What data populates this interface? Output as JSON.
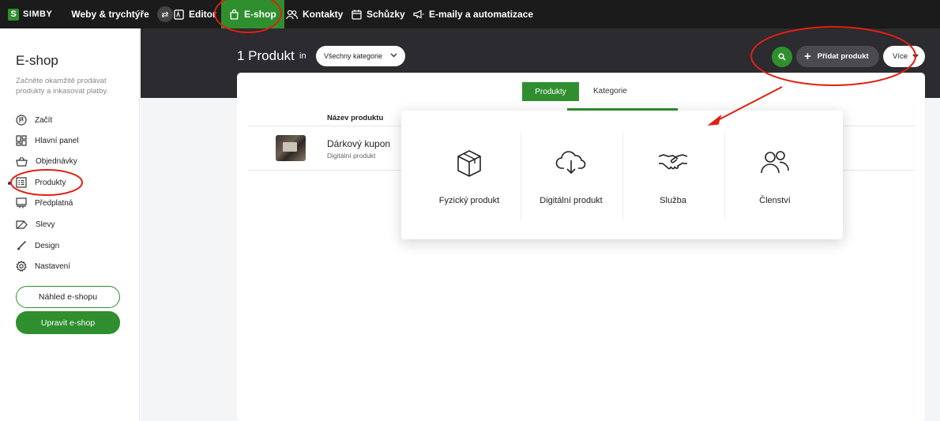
{
  "topbar": {
    "logo_letter": "S",
    "logo_text": "SIMBY",
    "site_name": "Weby & trychtýře",
    "swap_icon": "⇄",
    "nav": {
      "editor": "Editor",
      "eshop": "E-shop",
      "kontakty": "Kontakty",
      "schuzky": "Schůzky",
      "emaily": "E-maily a automatizace"
    }
  },
  "sidebar": {
    "title": "E-shop",
    "description": "Začněte okamžitě prodávat produkty a inkasovat platby.",
    "items": [
      {
        "label": "Začít",
        "icon": "flag-circle-icon"
      },
      {
        "label": "Hlavní panel",
        "icon": "dashboard-icon"
      },
      {
        "label": "Objednávky",
        "icon": "basket-icon"
      },
      {
        "label": "Produkty",
        "icon": "product-list-icon"
      },
      {
        "label": "Předplatná",
        "icon": "subscription-icon"
      },
      {
        "label": "Slevy",
        "icon": "discount-tag-icon"
      },
      {
        "label": "Design",
        "icon": "brush-icon"
      },
      {
        "label": "Nastavení",
        "icon": "gear-icon"
      }
    ],
    "preview_button": "Náhled e-shopu",
    "edit_button": "Upravit e-shop"
  },
  "main": {
    "heading": "1 Produkt",
    "heading_in": "in",
    "category_select": "Všechny kategorie",
    "add_product": "Přidat produkt",
    "more": "Více",
    "tabs": [
      "Produkty",
      "Kategorie"
    ],
    "table": {
      "column_header": "Název produktu",
      "rows": [
        {
          "name": "Dárkový kupon",
          "type": "Digitální produkt"
        }
      ]
    }
  },
  "dropdown": {
    "options": [
      {
        "label": "Fyzický produkt",
        "icon": "box-icon"
      },
      {
        "label": "Digitální produkt",
        "icon": "cloud-download-icon"
      },
      {
        "label": "Služba",
        "icon": "handshake-icon"
      },
      {
        "label": "Členství",
        "icon": "users-icon"
      }
    ]
  },
  "colors": {
    "accent": "#2f8f2f",
    "topbar": "#1b1b1b",
    "header_dark": "#2b2b30",
    "annotation": "#e02010"
  }
}
